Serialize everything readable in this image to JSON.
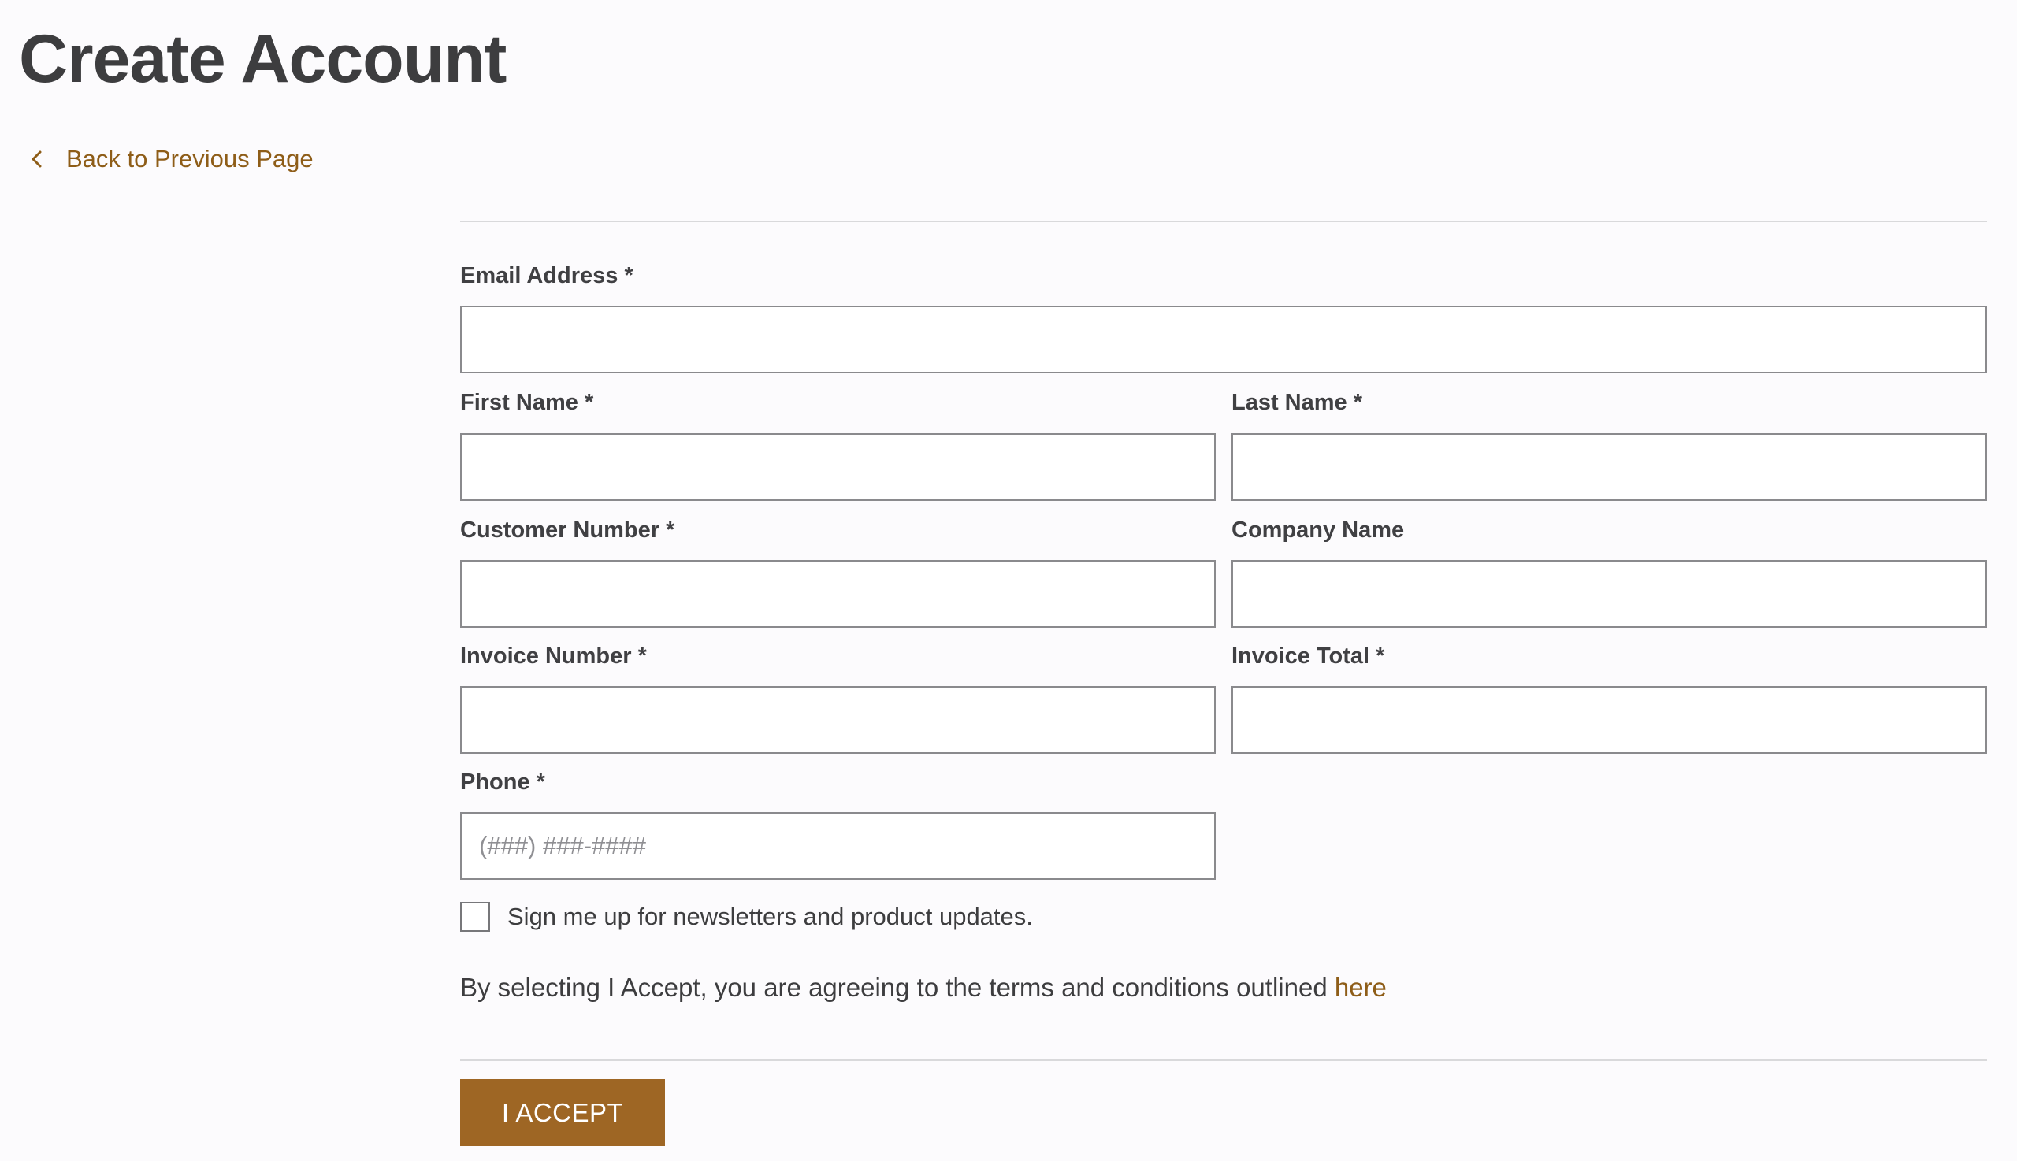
{
  "page": {
    "title": "Create Account",
    "back_link": "Back to Previous Page"
  },
  "form": {
    "email": {
      "label": "Email Address *",
      "value": "",
      "placeholder": ""
    },
    "first_name": {
      "label": "First Name *",
      "value": "",
      "placeholder": ""
    },
    "last_name": {
      "label": "Last Name *",
      "value": "",
      "placeholder": ""
    },
    "customer_number": {
      "label": "Customer Number *",
      "value": "",
      "placeholder": ""
    },
    "company_name": {
      "label": "Company Name",
      "value": "",
      "placeholder": ""
    },
    "invoice_number": {
      "label": "Invoice Number *",
      "value": "",
      "placeholder": ""
    },
    "invoice_total": {
      "label": "Invoice Total *",
      "value": "",
      "placeholder": ""
    },
    "phone": {
      "label": "Phone *",
      "value": "",
      "placeholder": "(###) ###-####"
    },
    "newsletter": {
      "label": "Sign me up for newsletters and product updates.",
      "checked": false
    },
    "terms_text": "By selecting I Accept, you are agreeing to the terms and conditions outlined ",
    "terms_link": "here",
    "accept_button": "I ACCEPT"
  },
  "colors": {
    "accent": "#9e6624",
    "link": "#8e5d18",
    "heading": "#3d3d3f",
    "input_border": "#8a8a8d"
  },
  "icons": {
    "back": "chevron-left-icon"
  }
}
